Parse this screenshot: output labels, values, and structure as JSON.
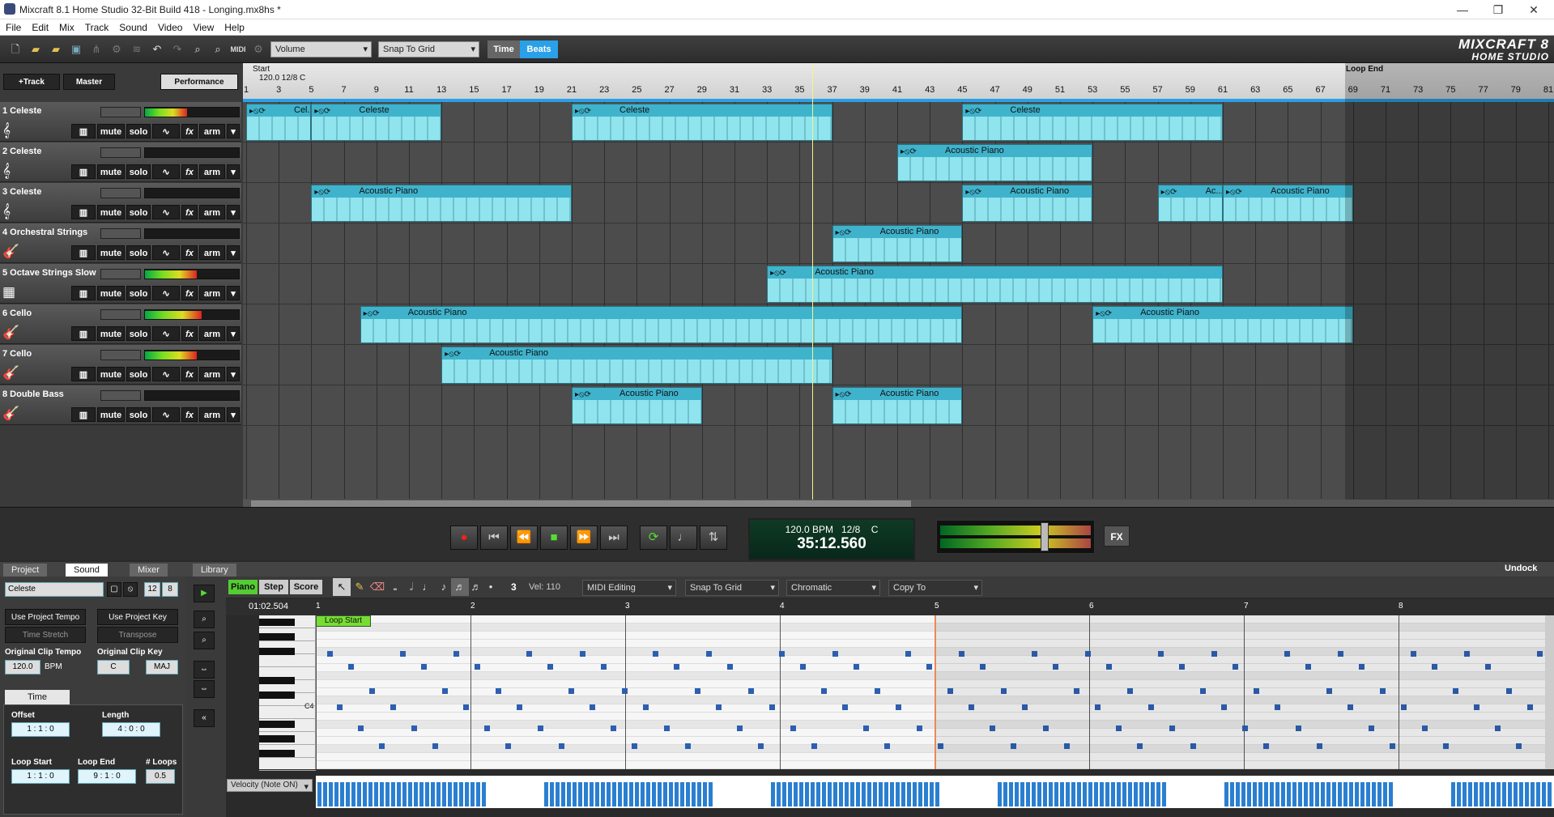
{
  "window": {
    "title": "Mixcraft 8.1 Home Studio 32-Bit Build 418 - Longing.mx8hs *"
  },
  "menu": [
    "File",
    "Edit",
    "Mix",
    "Track",
    "Sound",
    "Video",
    "View",
    "Help"
  ],
  "toolbar": {
    "automation_select": "Volume",
    "snap_select": "Snap To Grid",
    "time_label": "Time",
    "beats_label": "Beats",
    "logo_line1": "MIXCRAFT 8",
    "logo_line2": "HOME STUDIO"
  },
  "tracks_header": {
    "add_track": "+Track",
    "master": "Master",
    "performance": "Performance"
  },
  "ruler": {
    "start_label": "Start",
    "tempo_label": "120.0 12/8 C",
    "loop_end_label": "Loop End",
    "bars": [
      "1",
      "3",
      "5",
      "7",
      "9",
      "11",
      "13",
      "15",
      "17",
      "19",
      "21",
      "23",
      "25",
      "27",
      "29",
      "31",
      "33",
      "35",
      "37",
      "39",
      "41",
      "43",
      "45",
      "47",
      "49",
      "51",
      "53",
      "55",
      "57",
      "59",
      "61",
      "63",
      "65",
      "67",
      "69",
      "71",
      "73",
      "75",
      "77",
      "79",
      "81"
    ]
  },
  "tracks": [
    {
      "name": "1 Celeste",
      "icon": "treble-clef-icon",
      "level": 0.45,
      "clips": [
        {
          "label": "Cel...",
          "start": 1,
          "end": 5
        },
        {
          "label": "Celeste",
          "start": 5,
          "end": 13
        },
        {
          "label": "Celeste",
          "start": 21,
          "end": 37
        },
        {
          "label": "Celeste",
          "start": 45,
          "end": 61
        }
      ]
    },
    {
      "name": "2 Celeste",
      "icon": "treble-clef-icon",
      "level": 0.0,
      "clips": [
        {
          "label": "Acoustic Piano",
          "start": 41,
          "end": 53
        }
      ]
    },
    {
      "name": "3 Celeste",
      "icon": "treble-clef-icon",
      "level": 0.0,
      "clips": [
        {
          "label": "Acoustic Piano",
          "start": 5,
          "end": 21
        },
        {
          "label": "Acoustic Piano",
          "start": 45,
          "end": 53
        },
        {
          "label": "Ac...",
          "start": 57,
          "end": 61
        },
        {
          "label": "Acoustic Piano",
          "start": 61,
          "end": 69
        }
      ]
    },
    {
      "name": "4 Orchestral Strings",
      "icon": "guitar-icon",
      "level": 0.0,
      "clips": [
        {
          "label": "Acoustic Piano",
          "start": 37,
          "end": 45
        }
      ]
    },
    {
      "name": "5 Octave Strings Slow",
      "icon": "instrument-photo-icon",
      "level": 0.55,
      "clips": [
        {
          "label": "Acoustic Piano",
          "start": 33,
          "end": 61
        }
      ]
    },
    {
      "name": "6 Cello",
      "icon": "guitar-icon",
      "level": 0.6,
      "clips": [
        {
          "label": "Acoustic Piano",
          "start": 8,
          "end": 45
        },
        {
          "label": "Acoustic Piano",
          "start": 53,
          "end": 69
        }
      ]
    },
    {
      "name": "7 Cello",
      "icon": "guitar-icon",
      "level": 0.55,
      "clips": [
        {
          "label": "Acoustic Piano",
          "start": 13,
          "end": 37
        }
      ]
    },
    {
      "name": "8 Double Bass",
      "icon": "guitar-icon",
      "level": 0.0,
      "clips": [
        {
          "label": "Acoustic Piano",
          "start": 21,
          "end": 29
        },
        {
          "label": "Acoustic Piano",
          "start": 37,
          "end": 45
        }
      ]
    }
  ],
  "track_buttons": {
    "mute": "mute",
    "solo": "solo",
    "fx": "fx",
    "arm": "arm"
  },
  "transport": {
    "bpm": "120.0 BPM",
    "signature": "12/8",
    "key": "C",
    "time": "35:12.560",
    "fx": "FX"
  },
  "bottom_tabs": [
    "Project",
    "Sound",
    "Mixer",
    "Library"
  ],
  "undock": "Undock",
  "sound_panel": {
    "clip_name": "Celeste",
    "loop_beats": "12",
    "loop_div": "8",
    "use_project_tempo": "Use Project Tempo",
    "time_stretch": "Time Stretch",
    "use_project_key": "Use Project Key",
    "transpose": "Transpose",
    "orig_tempo_label": "Original Clip Tempo",
    "orig_tempo": "120.0",
    "bpm": "BPM",
    "orig_key_label": "Original Clip Key",
    "orig_key": "C",
    "orig_mode": "MAJ",
    "time_tab": "Time",
    "offset_label": "Offset",
    "offset": "1 : 1 : 0",
    "length_label": "Length",
    "length": "4 : 0 : 0",
    "loop_start_label": "Loop Start",
    "loop_start": "1 : 1 : 0",
    "loop_end_label": "Loop End",
    "loop_end": "9 : 1 : 0",
    "loops_label": "# Loops",
    "loops": "0.5"
  },
  "editor": {
    "mode_piano": "Piano",
    "mode_step": "Step",
    "mode_score": "Score",
    "vel_label": "Vel: 110",
    "triplet": "3",
    "midi_editing": "MIDI Editing",
    "snap": "Snap To Grid",
    "scale": "Chromatic",
    "copy": "Copy To",
    "position": "01:02.504",
    "loop_start": "Loop Start",
    "c4": "C4",
    "bars": [
      "1",
      "2",
      "3",
      "4",
      "5",
      "6",
      "7",
      "8"
    ],
    "velocity_select": "Velocity (Note ON)"
  }
}
